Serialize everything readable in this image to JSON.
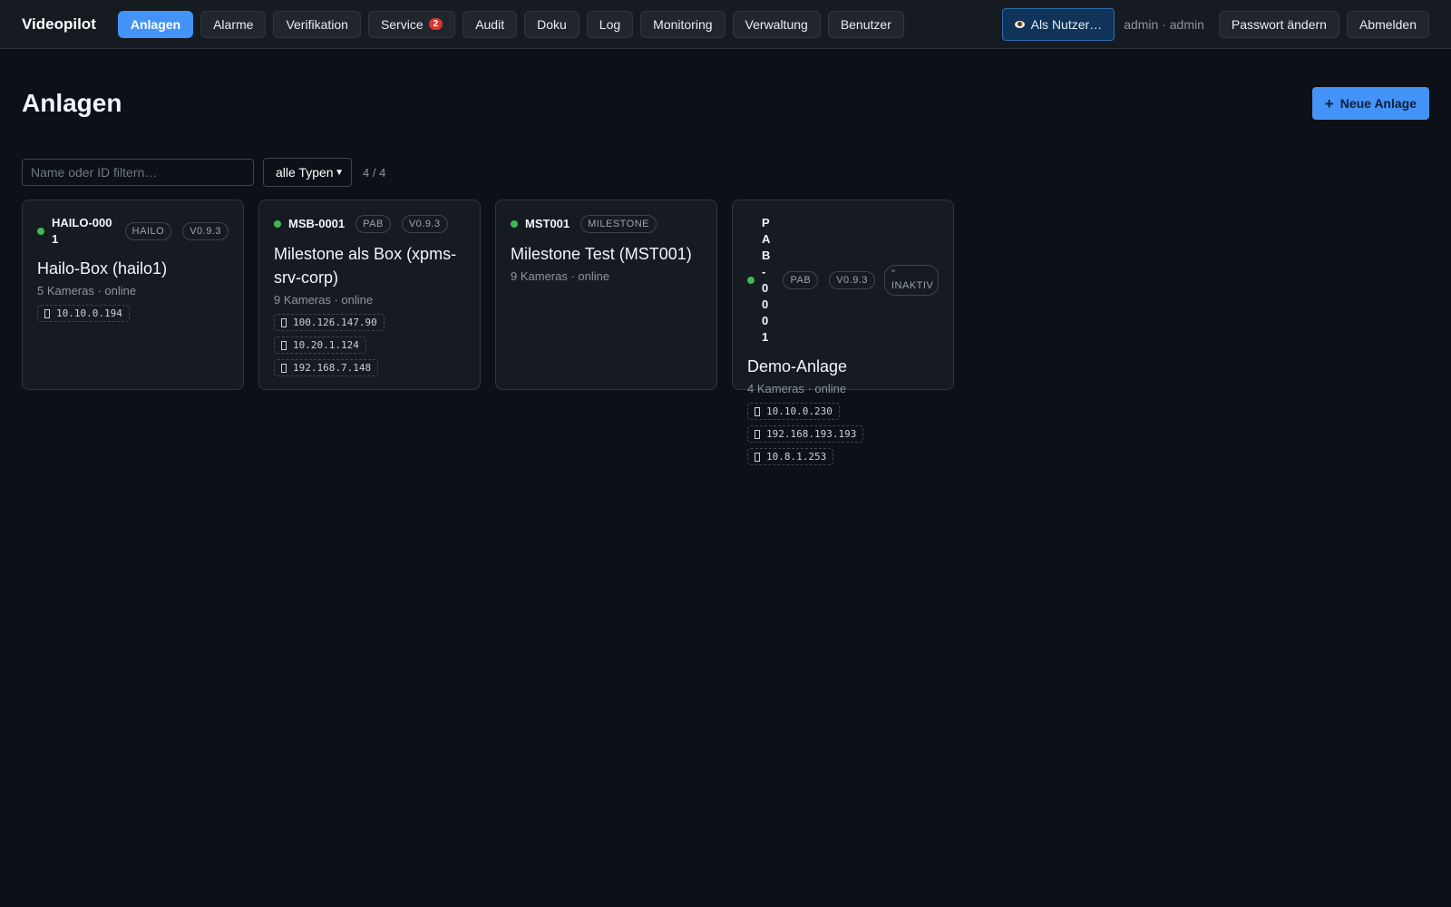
{
  "app": {
    "brand": "Videopilot"
  },
  "nav": {
    "items": [
      {
        "label": "Anlagen",
        "active": true
      },
      {
        "label": "Alarme"
      },
      {
        "label": "Verifikation"
      },
      {
        "label": "Service",
        "badge": "2"
      },
      {
        "label": "Audit"
      },
      {
        "label": "Doku"
      },
      {
        "label": "Log"
      },
      {
        "label": "Monitoring"
      },
      {
        "label": "Verwaltung"
      },
      {
        "label": "Benutzer"
      }
    ]
  },
  "user_area": {
    "impersonate_label": "Als Nutzer…",
    "user_label": "admin · admin",
    "change_password_label": "Passwort ändern",
    "logout_label": "Abmelden"
  },
  "page": {
    "title": "Anlagen",
    "new_button_label": "Neue Anlage"
  },
  "filters": {
    "search_placeholder": "Name oder ID filtern…",
    "search_value": "",
    "type_selected": "alle Typen",
    "result_count": "4 / 4"
  },
  "cards": [
    {
      "id": "HAILO-0001",
      "type": "HAILO",
      "version": "V0.9.3",
      "title": "Hailo-Box (hailo1)",
      "meta": "5 Kameras · online",
      "ips": [
        "10.10.0.194"
      ]
    },
    {
      "id": "MSB-0001",
      "type": "PAB",
      "version": "V0.9.3",
      "title": "Milestone als Box (xpms-srv-corp)",
      "meta": "9 Kameras · online",
      "ips": [
        "100.126.147.90",
        "10.20.1.124",
        "192.168.7.148"
      ]
    },
    {
      "id": "MST001",
      "type": "MILESTONE",
      "title": "Milestone Test (MST001)",
      "meta": "9 Kameras · online",
      "ips": []
    },
    {
      "id": "PAB-0001",
      "type": "PAB",
      "version": "V0.9.3",
      "status_tag": "\" INAKTIV",
      "title": "Demo-Anlage",
      "meta": "4 Kameras · online",
      "ips": [
        "10.10.0.230",
        "192.168.193.193",
        "10.8.1.253"
      ]
    }
  ],
  "colors": {
    "background": "#0d1117",
    "accent": "#4493f8",
    "online": "#3fb950",
    "badge": "#da3633"
  }
}
